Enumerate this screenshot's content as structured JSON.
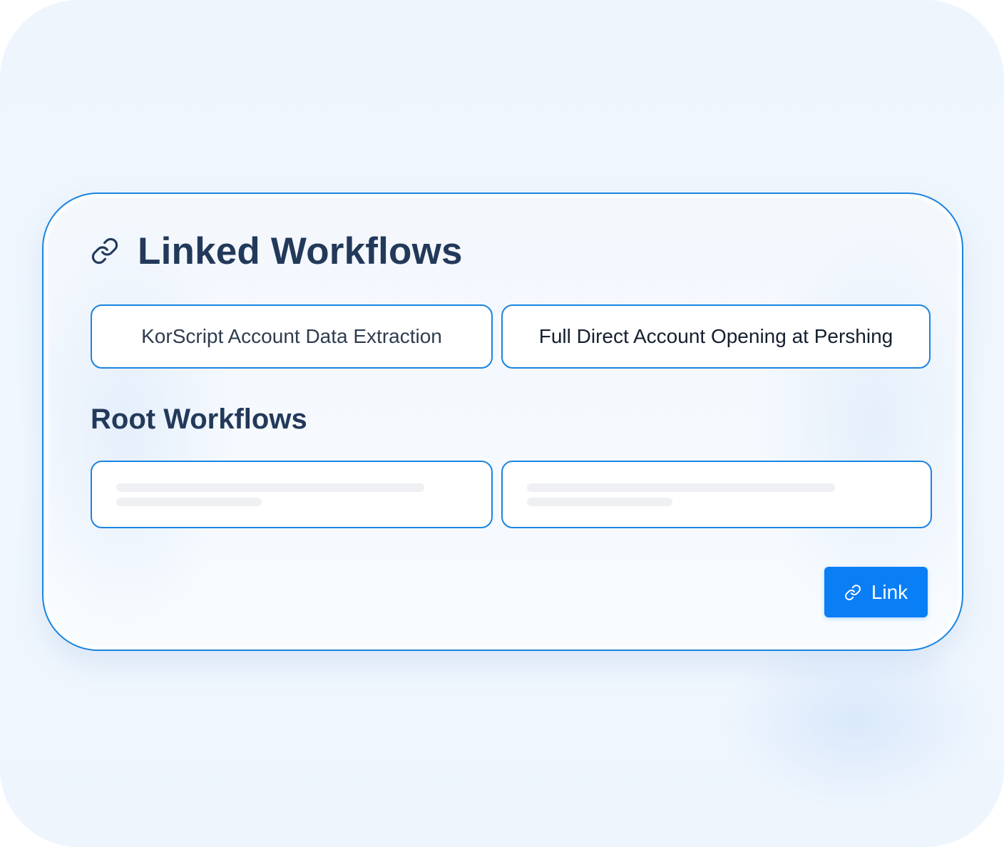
{
  "panel": {
    "title": "Linked Workflows",
    "title_icon": "link-icon",
    "linked_workflows": [
      {
        "label": "KorScript Account Data Extraction"
      },
      {
        "label": "Full Direct Account Opening at Pershing"
      }
    ],
    "root_section": {
      "title": "Root Workflows",
      "items_state": "loading-skeleton"
    },
    "link_button": {
      "label": "Link",
      "icon": "link-icon"
    }
  },
  "colors": {
    "accent": "#1a84e0",
    "button": "#0a7ef5",
    "heading": "#22395a",
    "background": "#eef5fd"
  }
}
